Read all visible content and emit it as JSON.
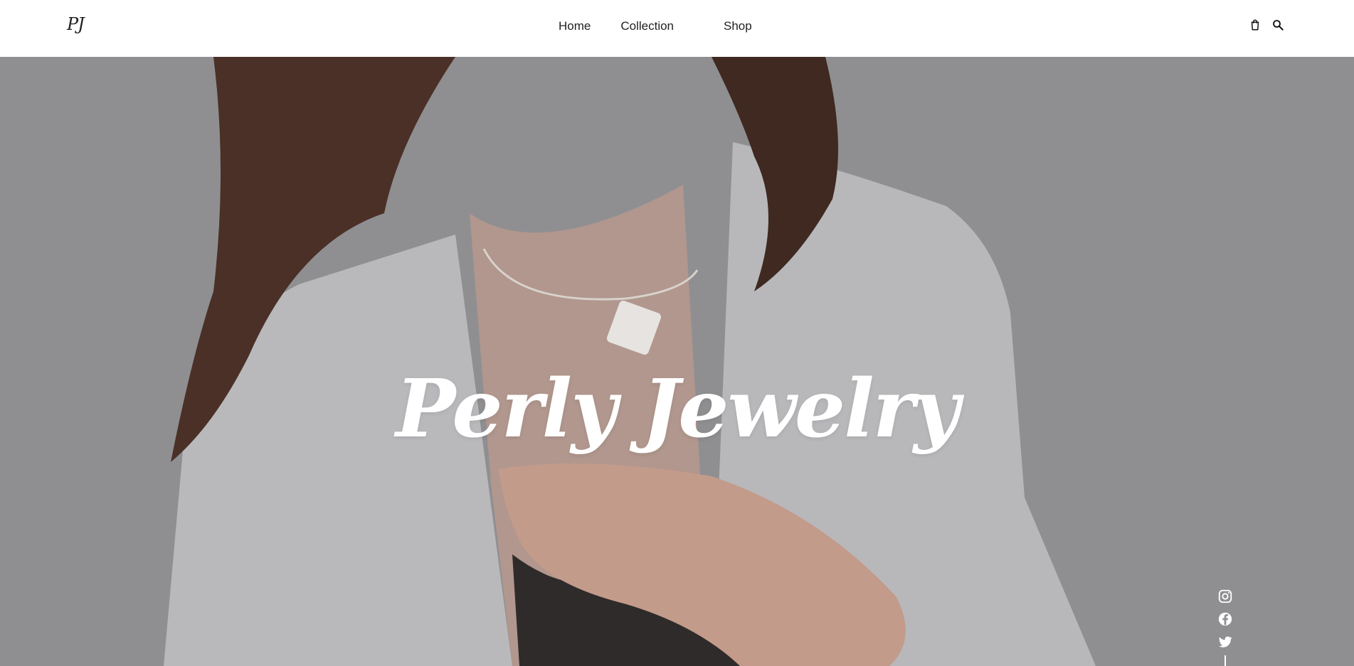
{
  "header": {
    "logo_text": "PJ",
    "nav": [
      {
        "label": "Home"
      },
      {
        "label": "Collection"
      },
      {
        "label": "Shop"
      }
    ],
    "icons": [
      "shopping-bag-icon",
      "search-icon"
    ]
  },
  "hero": {
    "title": "Perly Jewelry",
    "overlay_color": "#8f8f92"
  },
  "socials": {
    "icons": [
      "instagram-icon",
      "facebook-icon",
      "twitter-icon"
    ]
  }
}
